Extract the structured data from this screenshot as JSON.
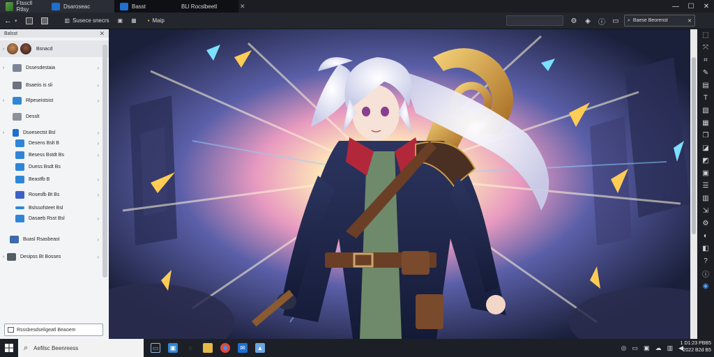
{
  "tabs": [
    {
      "label": "Ftsscll Rtlsy",
      "active": true
    },
    {
      "label": "Dsaroseac",
      "active": false
    },
    {
      "label": "Basst",
      "active": false
    },
    {
      "label": "BLl Rocslbeetl",
      "active": false
    }
  ],
  "window_controls": {
    "minimize": "—",
    "maximize": "☐",
    "close": "✕"
  },
  "toolbar": {
    "back": "←",
    "back_dropdown": "▾",
    "item1_label": "Susece snecrs",
    "item2_label": "Maip",
    "address_value": "",
    "search_box_label": "Baese Beorenst"
  },
  "sidebar": {
    "header": "Balsst",
    "items": [
      {
        "label": "Bsnacd",
        "icon": "avatar",
        "color": "#7a3b2a"
      },
      {
        "label": "Dssesdestaia",
        "icon": "folder-icon",
        "color": "#7b8596"
      },
      {
        "label": "Bsaeiis is sli",
        "icon": "user-icon",
        "color": "#6b7380"
      },
      {
        "label": "Rlpeseistsist",
        "icon": "window-icon",
        "color": "#2f86d6"
      },
      {
        "label": "Desslt",
        "icon": "file-icon",
        "color": "#8c929c"
      },
      {
        "label": "Dsoesectst Bsl",
        "icon": "bookmark-icon",
        "color": "#1f6fd1"
      },
      {
        "label": "Desens Bslt B",
        "icon": "chat-icon",
        "color": "#2f86d6"
      },
      {
        "label": "Besess Bstdt Bs",
        "icon": "chat-icon",
        "color": "#2f86d6"
      },
      {
        "label": "Duess Bsdt Bs",
        "icon": "chat-icon",
        "color": "#2f86d6"
      },
      {
        "label": "Beastfb B",
        "icon": "chat-icon",
        "color": "#2f86d6"
      },
      {
        "label": "Rosesfb Bt Bs",
        "icon": "book-icon",
        "color": "#3b62c4"
      },
      {
        "label": "Bslssofsteet Bsl",
        "icon": "dash-icon",
        "color": "#2f86d6"
      },
      {
        "label": "Dasaeb Rsst Bsl",
        "icon": "chat-icon",
        "color": "#2f86d6"
      },
      {
        "label": "Buasl Rsasbeast",
        "icon": "monitor-icon",
        "color": "#3d6aa8"
      },
      {
        "label": "Desipss Bt Bosses",
        "icon": "list-icon",
        "color": "#555c66"
      }
    ],
    "bottom_label": "Rsssbesdseligeatl Beaoem"
  },
  "taskbar": {
    "search_placeholder": "Aefilsc Beenreess"
  },
  "clock": {
    "time": "1 D1:23 PBB5",
    "date": "2022 B2d B5"
  },
  "colors": {
    "chrome_dark": "#1b1d23",
    "sidebar_bg": "#f3f4f6",
    "accent": "#1f6fd1"
  }
}
